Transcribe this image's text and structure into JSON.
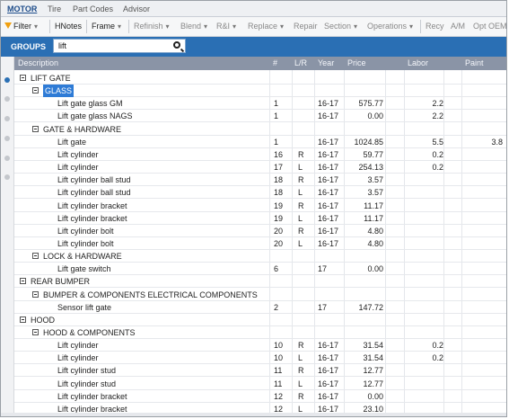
{
  "tabs": [
    "MOTOR",
    "Tire",
    "Part Codes",
    "Advisor"
  ],
  "toolbar": {
    "filter": "Filter",
    "hnotes": "HNotes",
    "frame": "Frame",
    "refinish": "Refinish",
    "blend": "Blend",
    "rni": "R&I",
    "replace": "Replace",
    "repair": "Repair",
    "section": "Section",
    "operations": "Operations",
    "recy": "Recy",
    "am": "A/M",
    "opt_oem": "Opt OEM"
  },
  "groups": {
    "label": "GROUPS",
    "search_value": "lift"
  },
  "columns": [
    "Description",
    "#",
    "L/R",
    "Year",
    "Price",
    "Labor",
    "Paint"
  ],
  "rows": [
    {
      "level": 0,
      "type": "group",
      "desc": "LIFT GATE"
    },
    {
      "level": 1,
      "type": "group",
      "desc": "GLASS",
      "selected": true
    },
    {
      "level": 2,
      "type": "part",
      "desc": "Lift gate glass GM",
      "num": "1",
      "lr": "",
      "year": "16-17",
      "price": "575.77",
      "labor": "2.2",
      "paint": ""
    },
    {
      "level": 2,
      "type": "part",
      "desc": "Lift gate glass NAGS",
      "num": "1",
      "lr": "",
      "year": "16-17",
      "price": "0.00",
      "labor": "2.2",
      "paint": ""
    },
    {
      "level": 1,
      "type": "group",
      "desc": "GATE & HARDWARE"
    },
    {
      "level": 2,
      "type": "part",
      "desc": "Lift gate",
      "num": "1",
      "lr": "",
      "year": "16-17",
      "price": "1024.85",
      "labor": "5.5",
      "paint": "3.8"
    },
    {
      "level": 2,
      "type": "part",
      "desc": "Lift cylinder",
      "num": "16",
      "lr": "R",
      "year": "16-17",
      "price": "59.77",
      "labor": "0.2",
      "paint": ""
    },
    {
      "level": 2,
      "type": "part",
      "desc": "Lift cylinder",
      "num": "17",
      "lr": "L",
      "year": "16-17",
      "price": "254.13",
      "labor": "0.2",
      "paint": ""
    },
    {
      "level": 2,
      "type": "part",
      "desc": "Lift cylinder ball stud",
      "num": "18",
      "lr": "R",
      "year": "16-17",
      "price": "3.57",
      "labor": "",
      "paint": ""
    },
    {
      "level": 2,
      "type": "part",
      "desc": "Lift cylinder ball stud",
      "num": "18",
      "lr": "L",
      "year": "16-17",
      "price": "3.57",
      "labor": "",
      "paint": ""
    },
    {
      "level": 2,
      "type": "part",
      "desc": "Lift cylinder bracket",
      "num": "19",
      "lr": "R",
      "year": "16-17",
      "price": "11.17",
      "labor": "",
      "paint": ""
    },
    {
      "level": 2,
      "type": "part",
      "desc": "Lift cylinder bracket",
      "num": "19",
      "lr": "L",
      "year": "16-17",
      "price": "11.17",
      "labor": "",
      "paint": ""
    },
    {
      "level": 2,
      "type": "part",
      "desc": "Lift cylinder bolt",
      "num": "20",
      "lr": "R",
      "year": "16-17",
      "price": "4.80",
      "labor": "",
      "paint": ""
    },
    {
      "level": 2,
      "type": "part",
      "desc": "Lift cylinder bolt",
      "num": "20",
      "lr": "L",
      "year": "16-17",
      "price": "4.80",
      "labor": "",
      "paint": ""
    },
    {
      "level": 1,
      "type": "group",
      "desc": "LOCK & HARDWARE"
    },
    {
      "level": 2,
      "type": "part",
      "desc": "Lift gate switch",
      "num": "6",
      "lr": "",
      "year": "17",
      "price": "0.00",
      "labor": "",
      "paint": ""
    },
    {
      "level": 0,
      "type": "group",
      "desc": "REAR BUMPER"
    },
    {
      "level": 1,
      "type": "group",
      "desc": "BUMPER & COMPONENTS ELECTRICAL COMPONENTS"
    },
    {
      "level": 2,
      "type": "part",
      "desc": "Sensor lift gate",
      "num": "2",
      "lr": "",
      "year": "17",
      "price": "147.72",
      "labor": "",
      "paint": ""
    },
    {
      "level": 0,
      "type": "group",
      "desc": "HOOD"
    },
    {
      "level": 1,
      "type": "group",
      "desc": "HOOD & COMPONENTS"
    },
    {
      "level": 2,
      "type": "part",
      "desc": "Lift cylinder",
      "num": "10",
      "lr": "R",
      "year": "16-17",
      "price": "31.54",
      "labor": "0.2",
      "paint": ""
    },
    {
      "level": 2,
      "type": "part",
      "desc": "Lift cylinder",
      "num": "10",
      "lr": "L",
      "year": "16-17",
      "price": "31.54",
      "labor": "0.2",
      "paint": ""
    },
    {
      "level": 2,
      "type": "part",
      "desc": "Lift cylinder stud",
      "num": "11",
      "lr": "R",
      "year": "16-17",
      "price": "12.77",
      "labor": "",
      "paint": ""
    },
    {
      "level": 2,
      "type": "part",
      "desc": "Lift cylinder stud",
      "num": "11",
      "lr": "L",
      "year": "16-17",
      "price": "12.77",
      "labor": "",
      "paint": ""
    },
    {
      "level": 2,
      "type": "part",
      "desc": "Lift cylinder bracket",
      "num": "12",
      "lr": "R",
      "year": "16-17",
      "price": "0.00",
      "labor": "",
      "paint": ""
    },
    {
      "level": 2,
      "type": "part",
      "desc": "Lift cylinder bracket",
      "num": "12",
      "lr": "L",
      "year": "16-17",
      "price": "23.10",
      "labor": "",
      "paint": ""
    }
  ],
  "colors": {
    "accent": "#2a6fb4",
    "header": "#8a94a6",
    "selection": "#2e7bd6",
    "filter_icon": "#f0a010"
  },
  "icons": [
    "filter-icon",
    "search-icon",
    "collapse-box-icon",
    "caret-down-icon"
  ]
}
